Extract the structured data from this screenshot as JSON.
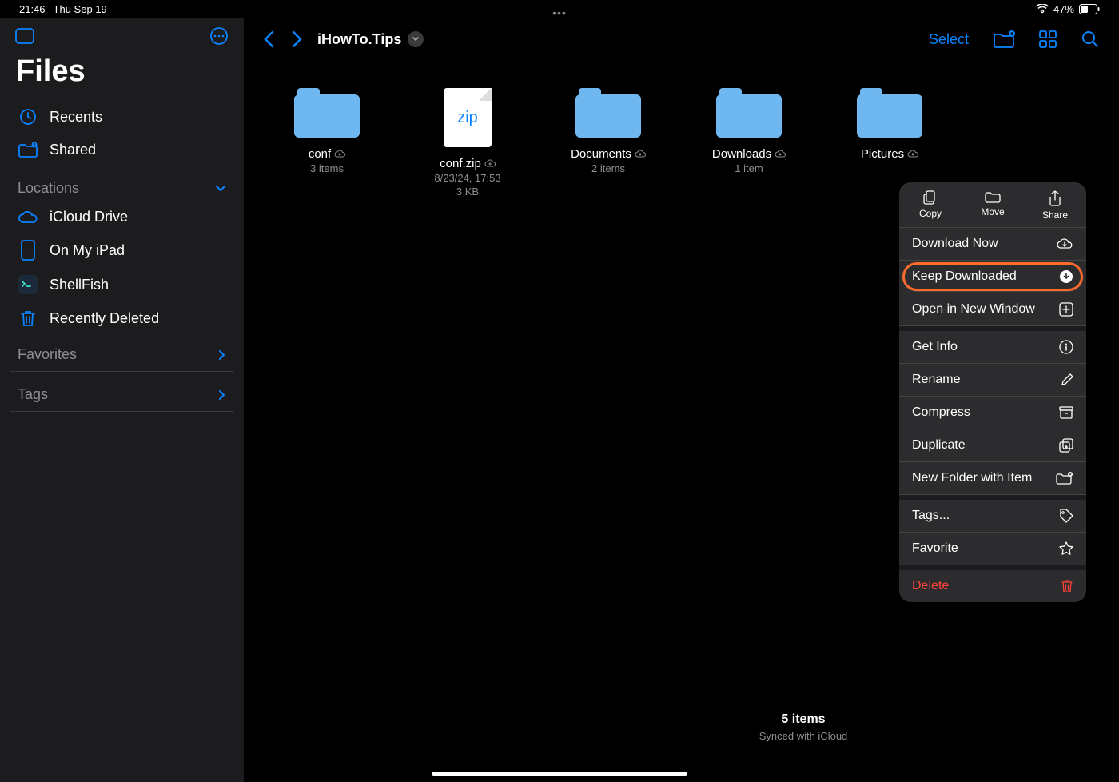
{
  "status": {
    "time": "21:46",
    "date": "Thu Sep 19",
    "battery": "47%"
  },
  "sidebar": {
    "title": "Files",
    "recents": "Recents",
    "shared": "Shared",
    "locations_header": "Locations",
    "locations": [
      {
        "label": "iCloud Drive"
      },
      {
        "label": "On My iPad"
      },
      {
        "label": "ShellFish"
      },
      {
        "label": "Recently Deleted"
      }
    ],
    "favorites_header": "Favorites",
    "tags_header": "Tags"
  },
  "toolbar": {
    "breadcrumb": "iHowTo.Tips",
    "select": "Select"
  },
  "items": [
    {
      "name": "conf",
      "sub": "3 items",
      "type": "folder"
    },
    {
      "name": "conf.zip",
      "sub": "8/23/24, 17:53",
      "sub2": "3 KB",
      "type": "zip"
    },
    {
      "name": "Documents",
      "sub": "2 items",
      "type": "folder"
    },
    {
      "name": "Downloads",
      "sub": "1 item",
      "type": "folder"
    },
    {
      "name": "Pictures",
      "sub": "",
      "type": "folder"
    }
  ],
  "menu": {
    "top": [
      {
        "label": "Copy"
      },
      {
        "label": "Move"
      },
      {
        "label": "Share"
      }
    ],
    "rows": [
      {
        "label": "Download Now",
        "icon": "cloud-down"
      },
      {
        "label": "Keep Downloaded",
        "icon": "circle-down",
        "highlight": true
      },
      {
        "label": "Open in New Window",
        "icon": "plus-square"
      },
      {
        "label": "Get Info",
        "icon": "info",
        "gap": true
      },
      {
        "label": "Rename",
        "icon": "pencil"
      },
      {
        "label": "Compress",
        "icon": "archive"
      },
      {
        "label": "Duplicate",
        "icon": "dup"
      },
      {
        "label": "New Folder with Item",
        "icon": "folder-plus"
      },
      {
        "label": "Tags...",
        "icon": "tag",
        "gap": true
      },
      {
        "label": "Favorite",
        "icon": "star"
      },
      {
        "label": "Delete",
        "icon": "trash",
        "gap": true,
        "destructive": true
      }
    ]
  },
  "footer": {
    "count": "5 items",
    "sync": "Synced with iCloud"
  }
}
